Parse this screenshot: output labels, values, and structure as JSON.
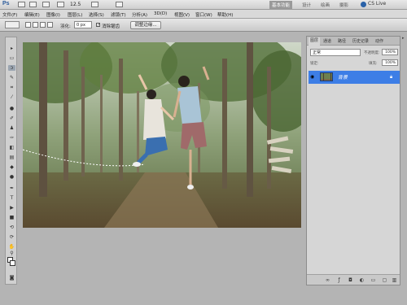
{
  "app": {
    "logo": "Ps",
    "zoom": "12.5",
    "workspace_active": "基本功能",
    "workspace_items": [
      "设计",
      "绘画",
      "摄影"
    ],
    "cs_live": "CS Live"
  },
  "menus": [
    "文件(F)",
    "编辑(E)",
    "图像(I)",
    "图层(L)",
    "选择(S)",
    "滤镜(T)",
    "分析(A)",
    "3D(D)",
    "视图(V)",
    "窗口(W)",
    "帮助(H)"
  ],
  "options": {
    "feather_label": "羽化:",
    "feather_value": "0 px",
    "antialias_label": "消除锯齿",
    "refine_edge": "调整边缘..."
  },
  "layers_panel": {
    "tabs": [
      "图层",
      "通道",
      "路径",
      "历史记录",
      "动作"
    ],
    "blend_mode": "正常",
    "opacity_label": "不透明度:",
    "opacity_value": "100%",
    "lock_label": "锁定:",
    "fill_label": "填充:",
    "fill_value": "100%",
    "layer_name": "背景"
  },
  "colors": {
    "selected_layer": "#3d7ee6",
    "workspace": "#b4b4b4"
  }
}
